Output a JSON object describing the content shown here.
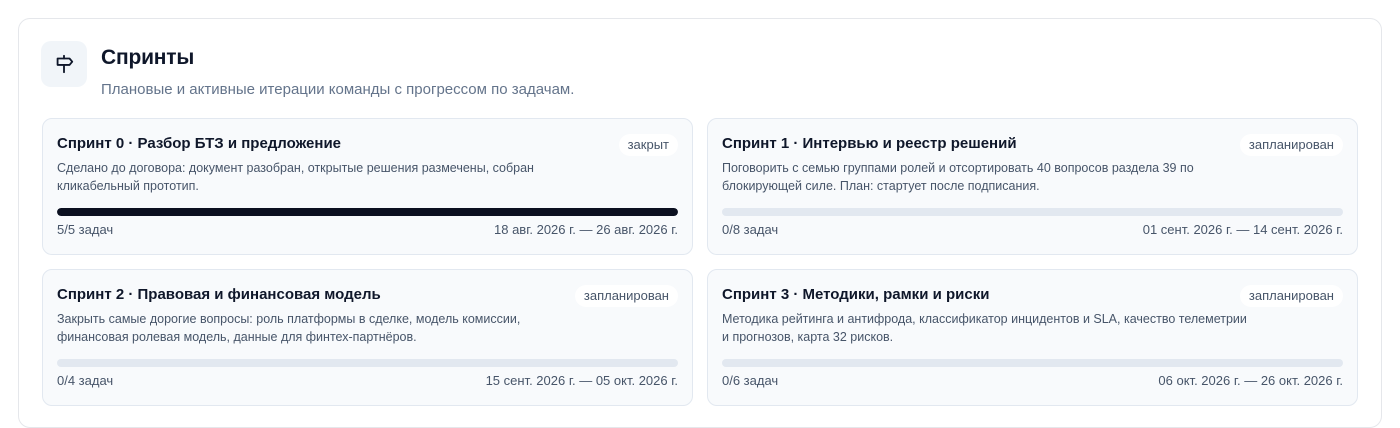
{
  "header": {
    "icon": "signpost-icon",
    "title": "Спринты",
    "subtitle": "Плановые и активные итерации команды с прогрессом по задачам."
  },
  "sprints": [
    {
      "title": "Спринт 0 · Разбор БТЗ и предложение",
      "status": "закрыт",
      "description": "Сделано до договора: документ разобран, открытые решения размечены, собран кликабельный прототип.",
      "progress": 1.0,
      "tasks": "5/5 задач",
      "dates": "18 авг. 2026 г. — 26 авг. 2026 г."
    },
    {
      "title": "Спринт 1 · Интервью и реестр решений",
      "status": "запланирован",
      "description": "Поговорить с семью группами ролей и отсортировать 40 вопросов раздела 39 по блокирующей силе. План: стартует после подписания.",
      "progress": 0.0,
      "tasks": "0/8 задач",
      "dates": "01 сент. 2026 г. — 14 сент. 2026 г."
    },
    {
      "title": "Спринт 2 · Правовая и финансовая модель",
      "status": "запланирован",
      "description": "Закрыть самые дорогие вопросы: роль платформы в сделке, модель комиссии, финансовая ролевая модель, данные для финтех-партнёров.",
      "progress": 0.0,
      "tasks": "0/4 задач",
      "dates": "15 сент. 2026 г. — 05 окт. 2026 г."
    },
    {
      "title": "Спринт 3 · Методики, рамки и риски",
      "status": "запланирован",
      "description": "Методика рейтинга и антифрода, классификатор инцидентов и SLA, качество телеметрии и прогнозов, карта 32 рисков.",
      "progress": 0.0,
      "tasks": "0/6 задач",
      "dates": "06 окт. 2026 г. — 26 окт. 2026 г."
    }
  ]
}
